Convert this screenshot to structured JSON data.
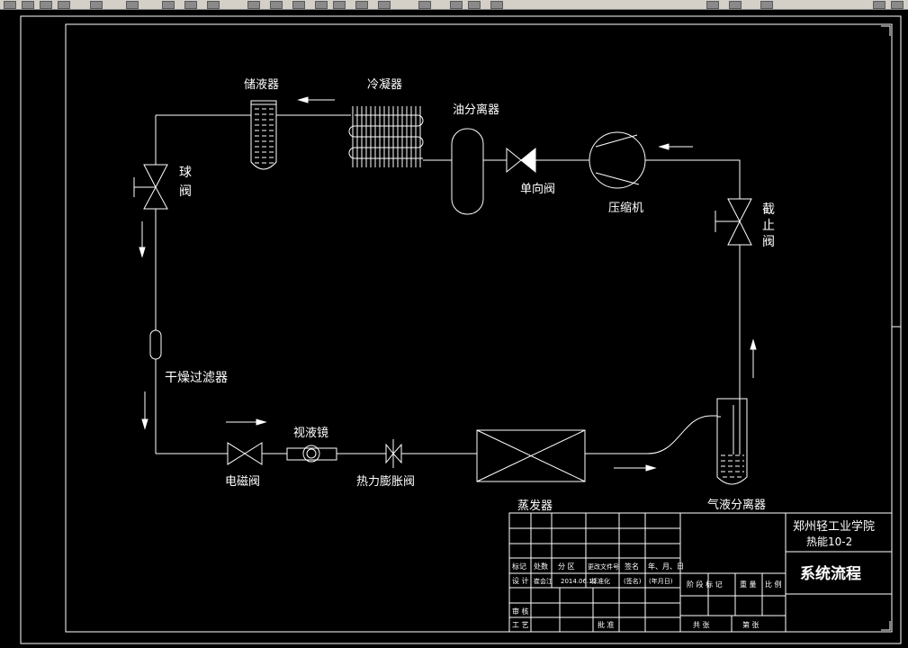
{
  "components": {
    "receiver": "储液器",
    "condenser": "冷凝器",
    "oil_separator": "油分离器",
    "check_valve": "单向阀",
    "compressor": "压缩机",
    "stop_valve": [
      "截",
      "止",
      "阀"
    ],
    "ball_valve": [
      "球",
      "阀"
    ],
    "drier_filter": "干燥过滤器",
    "solenoid_valve": "电磁阀",
    "sight_glass": "视液镜",
    "expansion_valve": "热力膨胀阀",
    "evaporator": "蒸发器",
    "gas_liquid_separator": "气液分离器"
  },
  "title_block": {
    "school": "郑州轻工业学院",
    "class": "热能10-2",
    "drawing_title": "系统流程",
    "row_headers": [
      "标记",
      "处数",
      "分 区",
      "更改文件号",
      "签名",
      "年、月、日"
    ],
    "design_label": "设 计",
    "designer": "崔会江",
    "design_date": "2014.06.12",
    "standardization": "标准化",
    "signature": "(签名)",
    "date_placeholder": "(年月日)",
    "stage_headers": [
      "阶 段 标 记",
      "重 量",
      "比 例"
    ],
    "review": "审 核",
    "process": "工 艺",
    "approve": "批 准",
    "sheets": [
      "共 张",
      "第 张"
    ]
  }
}
